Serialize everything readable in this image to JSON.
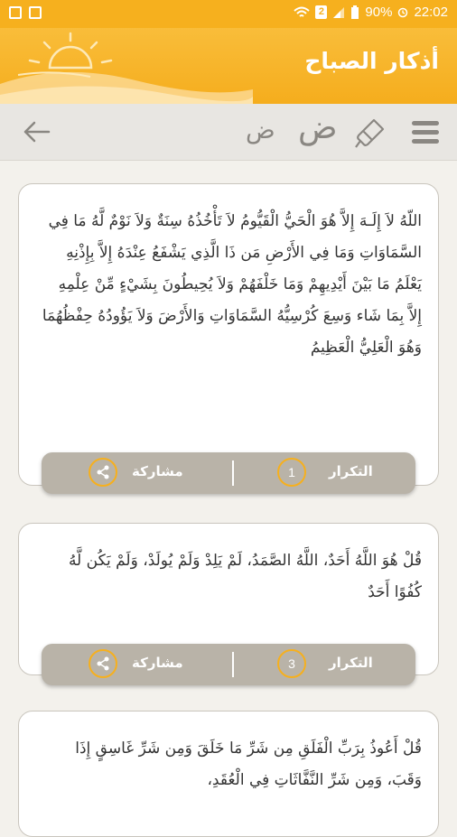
{
  "status_bar": {
    "battery": "90%",
    "time": "22:02",
    "sim": "2"
  },
  "header": {
    "title": "أذكار الصباح"
  },
  "toolbar": {
    "font_small": "ض",
    "font_large": "ض"
  },
  "cards": [
    {
      "text": "اللّهُ لاَ إِلَـهَ إِلاَّ هُوَ الْحَيُّ الْقَيُّومُ لاَ تَأْخُذُهُ سِنَةٌ وَلاَ نَوْمٌ لَّهُ مَا فِي السَّمَاوَاتِ وَمَا فِي الأَرْضِ مَن ذَا الَّذِي يَشْفَعُ عِنْدَهُ إِلاَّ بِإِذْنِهِ يَعْلَمُ مَا بَيْنَ أَيْدِيهِمْ وَمَا خَلْفَهُمْ وَلاَ يُحِيطُونَ بِشَيْءٍ مِّنْ عِلْمِهِ إِلاَّ بِمَا شَاء وَسِعَ كُرْسِيُّهُ السَّمَاوَاتِ وَالأَرْضَ وَلاَ يَؤُودُهُ حِفْظُهُمَا وَهُوَ الْعَلِيُّ الْعَظِيمُ",
      "repeat_label": "التكرار",
      "repeat_count": "1",
      "share_label": "مشاركة"
    },
    {
      "text": "قُلْ هُوَ اللَّهُ أَحَدٌ، اللَّهُ الصَّمَدُ، لَمْ يَلِدْ وَلَمْ يُولَدْ، وَلَمْ يَكُن لَّهُ كُفُوًا أَحَدٌ",
      "repeat_label": "التكرار",
      "repeat_count": "3",
      "share_label": "مشاركة"
    },
    {
      "text": "قُلْ أَعُوذُ بِرَبِّ الْفَلَقِ مِن شَرِّ مَا خَلَقَ وَمِن شَرِّ غَاسِقٍ إِذَا وَقَبَ، وَمِن شَرِّ النَّفَّاثَاتِ فِي الْعُقَدِ،"
    }
  ],
  "colors": {
    "accent": "#f6b01e",
    "bar": "#b9b3a8",
    "bg": "#f3f1ec"
  }
}
